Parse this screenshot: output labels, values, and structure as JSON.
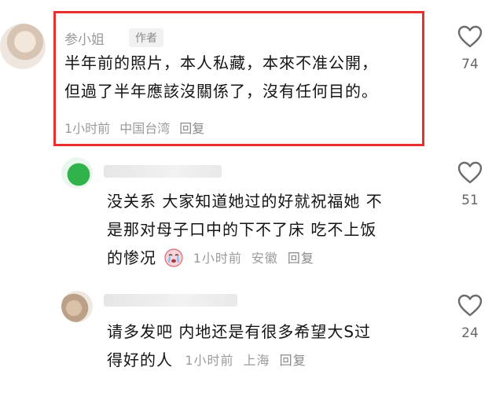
{
  "comments": [
    {
      "username": "参小姐",
      "badge": "作者",
      "text_lines": [
        "半年前的照片，本人私藏，本來不准公開，",
        "但過了半年應該沒關係了，沒有任何目的。"
      ],
      "time": "1小时前",
      "location": "中国台湾",
      "reply_label": "回复",
      "likes": "74"
    },
    {
      "text_lines": [
        "没关系 大家知道她过的好就祝福她 不",
        "是那对母子口中的下不了床 吃不上饭",
        "的惨况"
      ],
      "emoji": "crying-face-icon",
      "time": "1小时前",
      "location": "安徽",
      "reply_label": "回复",
      "likes": "51"
    },
    {
      "text_lines": [
        "请多发吧 内地还是有很多希望大S过",
        "得好的人"
      ],
      "time": "1小时前",
      "location": "上海",
      "reply_label": "回复",
      "likes": "24"
    }
  ],
  "colors": {
    "highlight_border": "#e8302c",
    "meta_text": "#9b9b9b",
    "body_text": "#141414"
  }
}
